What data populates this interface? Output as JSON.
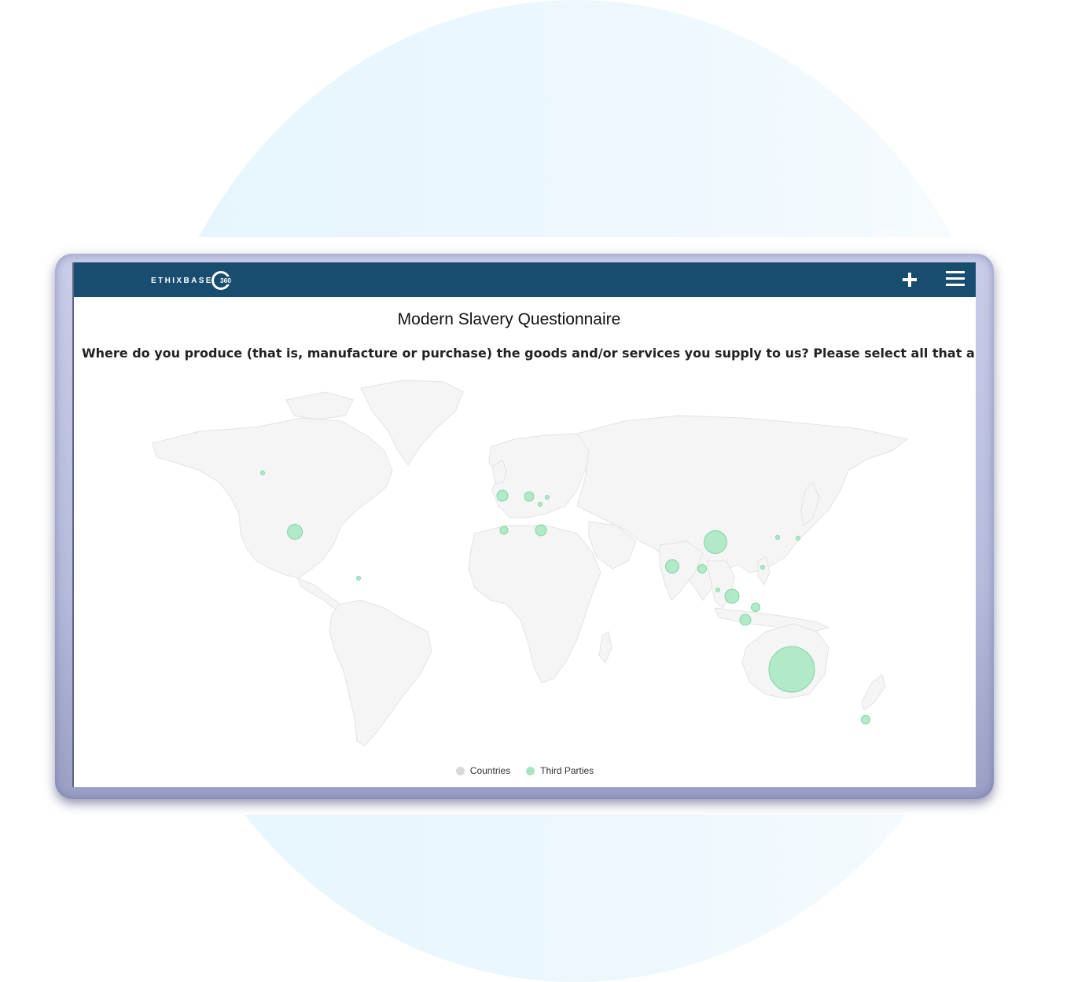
{
  "header": {
    "logo_text": "ETHIXBASE",
    "logo_number": "360",
    "add_icon": "plus-icon",
    "menu_icon": "hamburger-menu-icon"
  },
  "page": {
    "title": "Modern Slavery Questionnaire",
    "question": "Where do you produce (that is, manufacture or purchase) the goods and/or services you supply to us? Please select all that apply."
  },
  "map": {
    "legend": [
      {
        "label": "Countries",
        "color": "#d9d9d9"
      },
      {
        "label": "Third Parties",
        "color": "#a6e6c0"
      }
    ],
    "land_color": "#f5f5f5",
    "border_color": "#e3e3e3",
    "bubble_fill": "#a6e6c0",
    "bubble_stroke": "#7fd6a3"
  }
}
